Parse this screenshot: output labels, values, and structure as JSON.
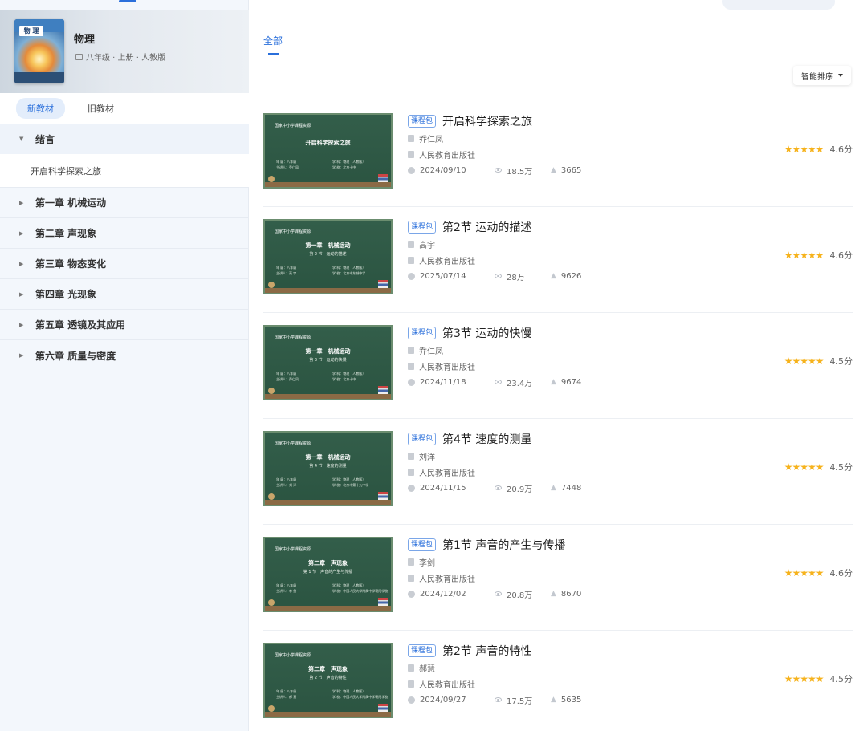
{
  "sidebar": {
    "book": {
      "cover_label": "物 理",
      "title": "物理",
      "meta": "八年级 · 上册 · 人教版"
    },
    "edition_tabs": [
      {
        "label": "新教材",
        "active": true
      },
      {
        "label": "旧教材",
        "active": false
      }
    ],
    "intro": {
      "label": "绪言",
      "expanded": true,
      "items": [
        "开启科学探索之旅"
      ]
    },
    "chapters": [
      {
        "label": "第一章 机械运动"
      },
      {
        "label": "第二章 声现象"
      },
      {
        "label": "第三章 物态变化"
      },
      {
        "label": "第四章 光现象"
      },
      {
        "label": "第五章 透镜及其应用"
      },
      {
        "label": "第六章 质量与密度"
      }
    ]
  },
  "main": {
    "filter_tab": "全部",
    "sort_label": "智能排序",
    "badge_label": "课程包",
    "courses": [
      {
        "title": "开启科学探索之旅",
        "author": "乔仁凤",
        "publisher": "人民教育出版社",
        "date": "2024/09/10",
        "views": "18.5万",
        "likes": "3665",
        "rating": "4.6分",
        "thumb": {
          "header": "国家中小学课程资源",
          "line1": "开启科学探索之旅",
          "line2": "",
          "info_l1": "年 级：八年级",
          "info_l2": "主讲人：乔仁凤",
          "info_r1": "学 科：物理（人教版）",
          "info_r2": "学 校：北京十中"
        }
      },
      {
        "title": "第2节 运动的描述",
        "author": "高宇",
        "publisher": "人民教育出版社",
        "date": "2025/07/14",
        "views": "28万",
        "likes": "9626",
        "rating": "4.6分",
        "thumb": {
          "header": "国家中小学课程资源",
          "line1": "第一章　机械运动",
          "line2": "第 2 节　运动的描述",
          "info_l1": "年 级：八年级",
          "info_l2": "主讲人：高 宇",
          "info_r1": "学 科：物理（人教版）",
          "info_r2": "学 校：北京市东城中学"
        }
      },
      {
        "title": "第3节 运动的快慢",
        "author": "乔仁凤",
        "publisher": "人民教育出版社",
        "date": "2024/11/18",
        "views": "23.4万",
        "likes": "9674",
        "rating": "4.5分",
        "thumb": {
          "header": "国家中小学课程资源",
          "line1": "第一章　机械运动",
          "line2": "第 3 节　运动的快慢",
          "info_l1": "年 级：八年级",
          "info_l2": "主讲人：乔仁凤",
          "info_r1": "学 科：物理（人教版）",
          "info_r2": "学 校：北京十中"
        }
      },
      {
        "title": "第4节 速度的测量",
        "author": "刘洋",
        "publisher": "人民教育出版社",
        "date": "2024/11/15",
        "views": "20.9万",
        "likes": "7448",
        "rating": "4.5分",
        "thumb": {
          "header": "国家中小学课程资源",
          "line1": "第一章　机械运动",
          "line2": "第 4 节　速度的测量",
          "info_l1": "年 级：八年级",
          "info_l2": "主讲人：刘 洋",
          "info_r1": "学 科：物理（人教版）",
          "info_r2": "学 校：北京市第十九中学"
        }
      },
      {
        "title": "第1节 声音的产生与传播",
        "author": "李剑",
        "publisher": "人民教育出版社",
        "date": "2024/12/02",
        "views": "20.8万",
        "likes": "8670",
        "rating": "4.6分",
        "thumb": {
          "header": "国家中小学课程资源",
          "line1": "第二章　声现象",
          "line2": "第 1 节　声音的产生与传播",
          "info_l1": "年 级：八年级",
          "info_l2": "主讲人：李 剑",
          "info_r1": "学 科：物理（人教版）",
          "info_r2": "学 校：中国人民大学附属中学朝阳学校"
        }
      },
      {
        "title": "第2节 声音的特性",
        "author": "郝慧",
        "publisher": "人民教育出版社",
        "date": "2024/09/27",
        "views": "17.5万",
        "likes": "5635",
        "rating": "4.5分",
        "thumb": {
          "header": "国家中小学课程资源",
          "line1": "第二章　声现象",
          "line2": "第 2 节　声音的特性",
          "info_l1": "年 级：八年级",
          "info_l2": "主讲人：郝 慧",
          "info_r1": "学 科：物理（人教版）",
          "info_r2": "学 校：中国人民大学附属中学朝阳学校"
        }
      }
    ]
  }
}
